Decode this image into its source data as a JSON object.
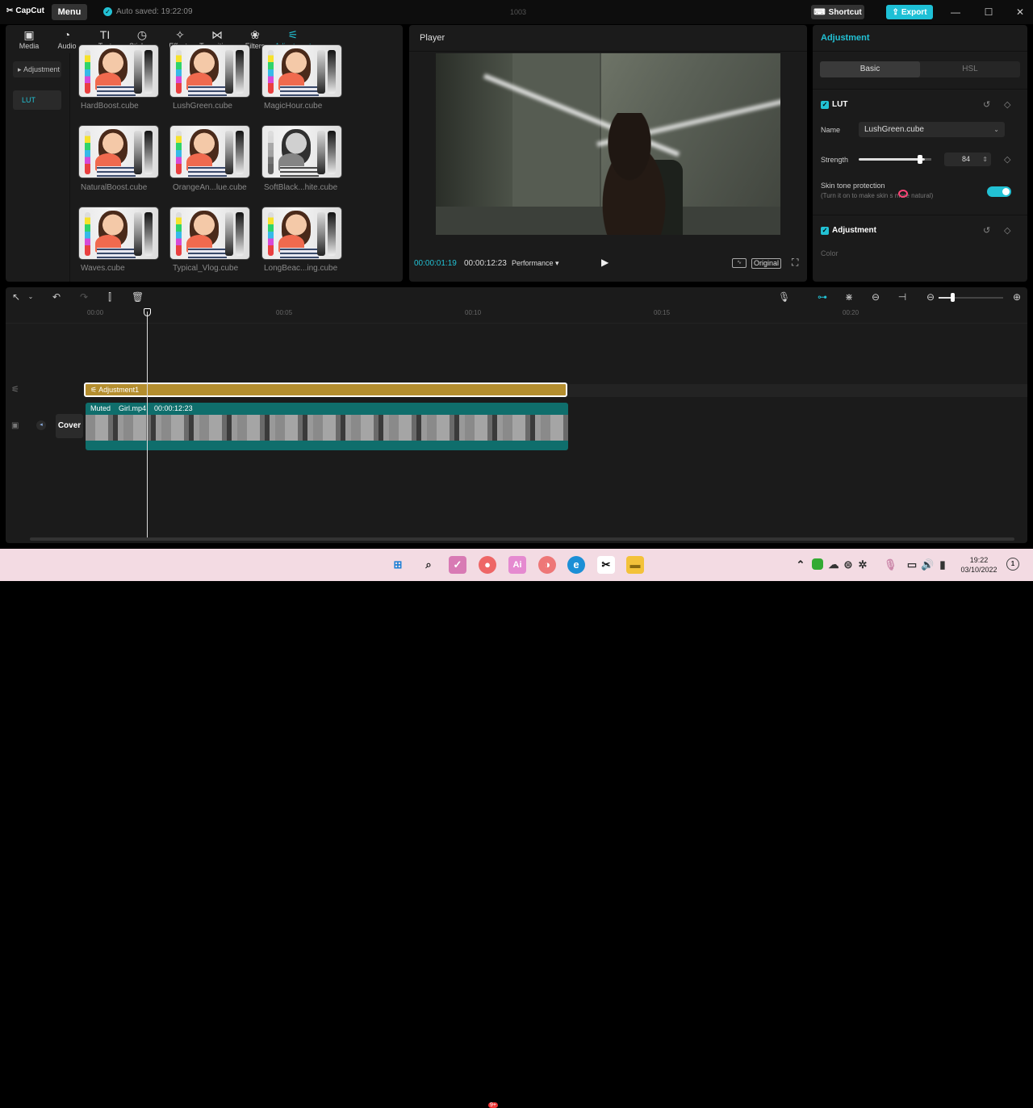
{
  "app": {
    "logo": "CapCut",
    "menu": "Menu",
    "autosave": "Auto saved: 19:22:09",
    "project_title": "1003",
    "shortcut": "Shortcut",
    "export": "Export"
  },
  "tabs": [
    {
      "label": "Media",
      "icon": "media-icon"
    },
    {
      "label": "Audio",
      "icon": "audio-icon"
    },
    {
      "label": "Text",
      "icon": "text-icon"
    },
    {
      "label": "Stickers",
      "icon": "stickers-icon"
    },
    {
      "label": "Effects",
      "icon": "effects-icon"
    },
    {
      "label": "Transitions",
      "icon": "transitions-icon"
    },
    {
      "label": "Filters",
      "icon": "filters-icon"
    },
    {
      "label": "Adjustment",
      "icon": "adjustment-icon"
    }
  ],
  "leftnav": {
    "parent": "Adjustment",
    "selected": "LUT"
  },
  "luts": [
    "HardBoost.cube",
    "LushGreen.cube",
    "MagicHour.cube",
    "NaturalBoost.cube",
    "OrangeAn...lue.cube",
    "SoftBlack...hite.cube",
    "Waves.cube",
    "Typical_Vlog.cube",
    "LongBeac...ing.cube"
  ],
  "player": {
    "title": "Player",
    "current_time": "00:00:01:19",
    "total_time": "00:00:12:23",
    "performance": "Performance",
    "original": "Original"
  },
  "adjustment": {
    "title": "Adjustment",
    "tabs": {
      "basic": "Basic",
      "hsl": "HSL"
    },
    "lut_section": "LUT",
    "name_label": "Name",
    "name_value": "LushGreen.cube",
    "strength_label": "Strength",
    "strength_value": "84",
    "strength_level": 0.84,
    "skin_label": "Skin tone protection",
    "skin_hint": "(Turn it on to make skin  s more natural)",
    "skin_on": true,
    "adjust_section": "Adjustment",
    "color_label": "Color"
  },
  "timeline": {
    "ticks": [
      "00:00",
      "00:05",
      "00:10",
      "00:15",
      "00:20"
    ],
    "adj_clip": "Adjustment1",
    "video_muted": "Muted",
    "video_name": "Girl.mp4",
    "video_duration": "00:00:12:23",
    "cover": "Cover"
  },
  "taskbar": {
    "time": "19:22",
    "date": "03/10/2022",
    "badge": "9+"
  }
}
